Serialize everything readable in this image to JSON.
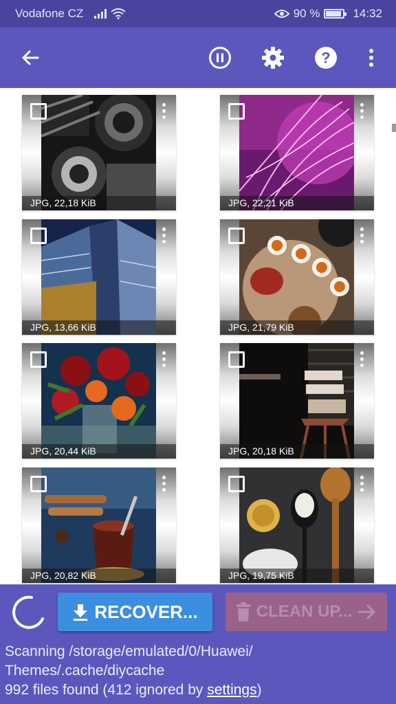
{
  "status_bar": {
    "carrier": "Vodafone CZ",
    "battery_percent_label": "90 %",
    "battery_level": 0.9,
    "time": "14:32"
  },
  "toolbar": {
    "icons": [
      "back-arrow-icon",
      "pause-icon",
      "gear-icon",
      "help-icon",
      "more-vert-icon"
    ]
  },
  "items": [
    {
      "caption": "JPG, 22,18 KiB",
      "photo": "motorcycle-engine"
    },
    {
      "caption": "JPG, 22,21 KiB",
      "photo": "pink-feathers"
    },
    {
      "caption": "JPG, 13,66 KiB",
      "photo": "building-facade"
    },
    {
      "caption": "JPG, 21,79 KiB",
      "photo": "tea-set"
    },
    {
      "caption": "JPG, 20,44 KiB",
      "photo": "red-flowers"
    },
    {
      "caption": "JPG, 20,18 KiB",
      "photo": "wooden-chair"
    },
    {
      "caption": "JPG, 20,82 KiB",
      "photo": "tea-glass-cinnamon"
    },
    {
      "caption": "JPG, 19,75 KiB",
      "photo": "spoons-spices"
    }
  ],
  "actions": {
    "recover_label": "RECOVER...",
    "clean_label": "CLEAN UP..."
  },
  "scan": {
    "path_text": "Scanning /storage/emulated/0/Huawei/\nThemes/.cache/diycache",
    "count_prefix": "992 files found (412 ignored by ",
    "settings_link": "settings",
    "count_suffix": ")"
  },
  "colors": {
    "status_bar": "#4a449f",
    "toolbar": "#5b57bd",
    "recover_button": "#3c8ee0",
    "clean_button": "#9a6289"
  }
}
